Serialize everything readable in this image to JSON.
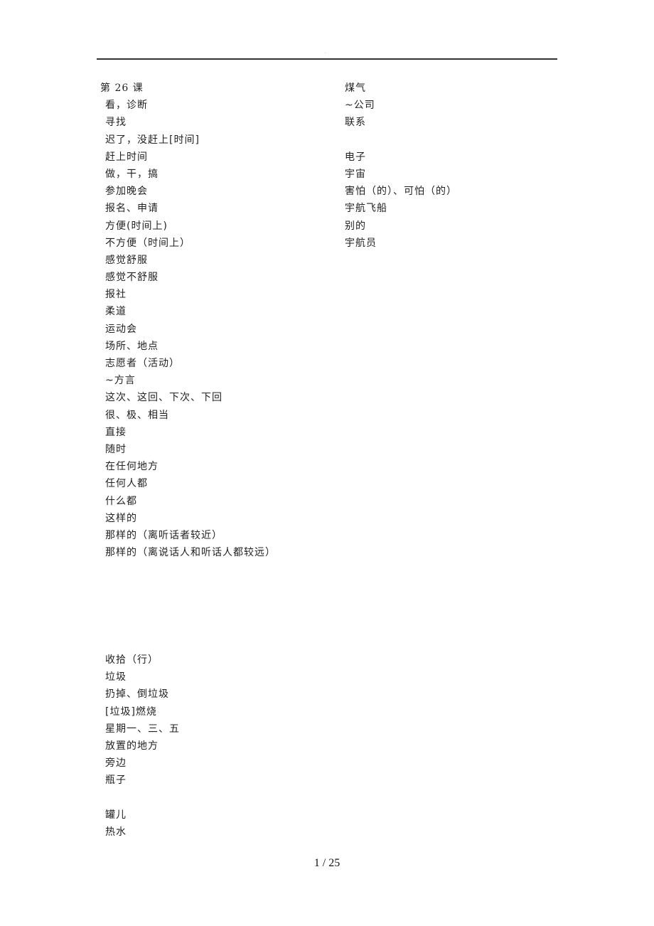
{
  "header": {
    "mark": "."
  },
  "left_column": {
    "title": "第 26 课",
    "items": [
      "看，诊断",
      "寻找",
      "迟了，没赶上[时间]",
      "赶上时间",
      "做，干，搞",
      "参加晚会",
      "报名、申请",
      "方便(时间上)",
      "不方便（时间上）",
      "感觉舒服",
      "感觉不舒服",
      "报社",
      "柔道",
      "运动会",
      "场所、地点",
      "志愿者（活动）",
      "~方言",
      "这次、这回、下次、下回",
      "很、极、相当",
      "直接",
      "随时",
      "在任何地方",
      "任何人都",
      "什么都",
      "这样的",
      "那样的（离听话者较近）",
      "那样的（离说话人和听话人都较远）"
    ]
  },
  "right_column": {
    "items": [
      "煤气",
      "~公司",
      "联系",
      "",
      "电子",
      "宇宙",
      "害怕（的）、可怕（的）",
      "宇航飞船",
      "别的",
      "宇航员"
    ]
  },
  "left_column_2": {
    "items": [
      "收拾（行）",
      "垃圾",
      "扔掉、倒垃圾",
      "[垃圾]燃烧",
      "星期一、三、五",
      "放置的地方",
      "旁边",
      "瓶子",
      "",
      "罐儿",
      "热水"
    ]
  },
  "footer": {
    "page": "1 / 25"
  }
}
